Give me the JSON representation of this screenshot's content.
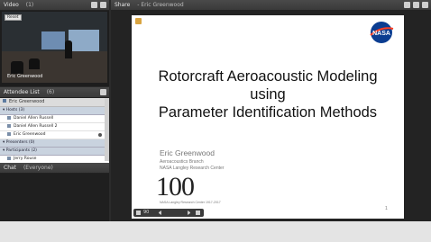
{
  "video": {
    "title": "Video",
    "count": "(1)",
    "reset_label": "Reset",
    "presenter_label": "Eric Greenwood"
  },
  "share": {
    "title": "Share",
    "presenter": "- Eric Greenwood"
  },
  "attendees": {
    "title": "Attendee List",
    "count": "(6)",
    "current_user": "Eric Greenwood",
    "groups": [
      {
        "label": "Hosts (3)",
        "members": [
          "Daniel Allen Russell",
          "Daniel Allen Russell 2",
          "Eric Greenwood"
        ]
      },
      {
        "label": "Presenters (0)",
        "members": []
      },
      {
        "label": "Participants (2)",
        "members": [
          "Jerry Rouse",
          "michael a"
        ]
      }
    ]
  },
  "chat": {
    "title": "Chat",
    "scope": "(Everyone)"
  },
  "slide": {
    "title_lines": [
      "Rotorcraft Aeroacoustic Modeling",
      "using",
      "Parameter Identification Methods"
    ],
    "presenter_name": "Eric Greenwood",
    "presenter_lines": [
      "Aeroacoustics Branch",
      "NASA Langley Research Center"
    ],
    "centennial_number": "100",
    "centennial_caption": "NASA Langley Research Center 1917-2017",
    "page_number": "1",
    "logo_text": "NASA",
    "zoom": "90"
  },
  "colors": {
    "nasa_blue": "#0b3d91",
    "nasa_red": "#fc3d21"
  }
}
